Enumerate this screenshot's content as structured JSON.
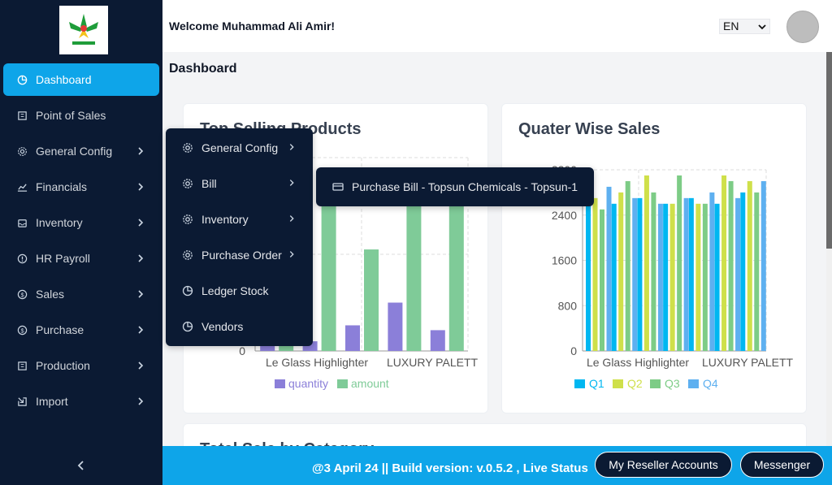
{
  "sidebar": {
    "items": [
      {
        "label": "Dashboard",
        "icon": "pie-chart-icon"
      },
      {
        "label": "Point of Sales",
        "icon": "building-icon"
      },
      {
        "label": "General Config",
        "icon": "gear-icon"
      },
      {
        "label": "Financials",
        "icon": "line-chart-icon"
      },
      {
        "label": "Inventory",
        "icon": "inbox-icon"
      },
      {
        "label": "HR Payroll",
        "icon": "info-circle-icon"
      },
      {
        "label": "Sales",
        "icon": "dollar-circle-icon"
      },
      {
        "label": "Purchase",
        "icon": "dollar-circle-icon"
      },
      {
        "label": "Production",
        "icon": "building-icon"
      },
      {
        "label": "Import",
        "icon": "import-icon"
      }
    ]
  },
  "header": {
    "welcome": "Welcome Muhammad Ali Amir!",
    "language": "EN"
  },
  "page": {
    "title": "Dashboard"
  },
  "cards": {
    "top_selling": "Top Selling Products",
    "quarter": "Quater Wise Sales",
    "category": "Total Sale by Category"
  },
  "colors": {
    "accent": "#0ea5e9",
    "sidebar_bg": "#0b1a33",
    "quantity": "#8b7fd9",
    "amount": "#7fcb98",
    "q1": "#00b7f1",
    "q2": "#cfe04a",
    "q3": "#7dcc86",
    "q4": "#5eb0f0"
  },
  "chart_data": [
    {
      "type": "bar",
      "title": "Top Selling Products",
      "tick_labels_x": [
        "Le Glass Highlighter",
        "LUXURY PALETT"
      ],
      "tick_labels_y": [
        "0"
      ],
      "series": [
        {
          "name": "quantity",
          "values": [
            190,
            200,
            530,
            1000,
            430
          ]
        },
        {
          "name": "amount",
          "values": [
            2300,
            3300,
            2100,
            3300,
            3300
          ]
        }
      ],
      "legend": "bottom"
    },
    {
      "type": "bar",
      "title": "Quater Wise Sales",
      "tick_labels_x": [
        "Le Glass Highlighter",
        "LUXURY PALETT"
      ],
      "ylim": [
        0,
        3200
      ],
      "yticks": [
        "0",
        "800",
        "1600",
        "2400",
        "3200"
      ],
      "series": [
        {
          "name": "Q1",
          "values": [
            2600,
            2600,
            2700,
            2600,
            2700,
            2600,
            2800
          ]
        },
        {
          "name": "Q2",
          "values": [
            2700,
            2800,
            3100,
            2600,
            2600,
            3100,
            3000
          ]
        },
        {
          "name": "Q3",
          "values": [
            2500,
            3000,
            2800,
            3100,
            2600,
            3000,
            2800
          ]
        },
        {
          "name": "Q4",
          "values": [
            2900,
            2700,
            2600,
            2700,
            2800,
            2700,
            3000
          ]
        }
      ],
      "legend": "bottom"
    }
  ],
  "submenu": {
    "items": [
      {
        "label": "General Config",
        "icon": "gear-icon",
        "has_children": true
      },
      {
        "label": "Bill",
        "icon": "gear-icon",
        "has_children": true
      },
      {
        "label": "Inventory",
        "icon": "gear-icon",
        "has_children": true
      },
      {
        "label": "Purchase Order",
        "icon": "gear-icon",
        "has_children": true
      },
      {
        "label": "Ledger Stock",
        "icon": "pie-chart-icon",
        "has_children": false
      },
      {
        "label": "Vendors",
        "icon": "pie-chart-icon",
        "has_children": false
      }
    ],
    "bill_child": {
      "label": "Purchase Bill - Topsun Chemicals - Topsun-1",
      "icon": "card-icon"
    }
  },
  "footer": {
    "build": "@3 April 24 || Build version: v.0.5.2 , Live Status",
    "reseller": "My Reseller Accounts",
    "messenger": "Messenger"
  }
}
